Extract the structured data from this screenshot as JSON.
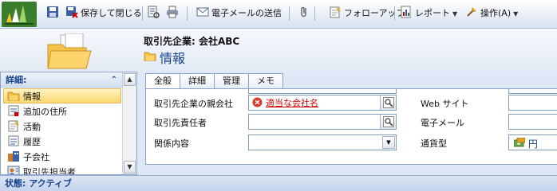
{
  "toolbar": {
    "save_close": "保存して閉じる",
    "send_email": "電子メールの送信",
    "follow_up": "フォローアップ",
    "report": "レポート",
    "actions": "操作(A)"
  },
  "header": {
    "entity_title": "取引先企業: 会社ABC",
    "form_title": "情報"
  },
  "nav": {
    "header": "詳細:",
    "collapse_glyph": "⌃",
    "items": [
      {
        "label": "情報",
        "icon": "info-icon",
        "selected": true
      },
      {
        "label": "追加の住所",
        "icon": "address-icon"
      },
      {
        "label": "活動",
        "icon": "activity-icon"
      },
      {
        "label": "履歴",
        "icon": "history-icon"
      },
      {
        "label": "子会社",
        "icon": "subsidiary-icon"
      },
      {
        "label": "取引先担当者",
        "icon": "contact-icon"
      }
    ]
  },
  "tabs": [
    {
      "label": "全般",
      "active": true
    },
    {
      "label": "詳細"
    },
    {
      "label": "管理"
    },
    {
      "label": "メモ"
    }
  ],
  "form": {
    "parent_account_label": "取引先企業の親会社",
    "parent_account_value": "適当な会社名",
    "primary_contact_label": "取引先責任者",
    "relationship_label": "関係内容",
    "website_label": "Web サイト",
    "email_label": "電子メール",
    "currency_label": "通貨型",
    "currency_value": "円"
  },
  "status": {
    "text": "状態: アクティブ"
  },
  "colors": {
    "accent": "#15428b",
    "error_link": "#cc0000",
    "selected_nav": "#fbd771"
  }
}
